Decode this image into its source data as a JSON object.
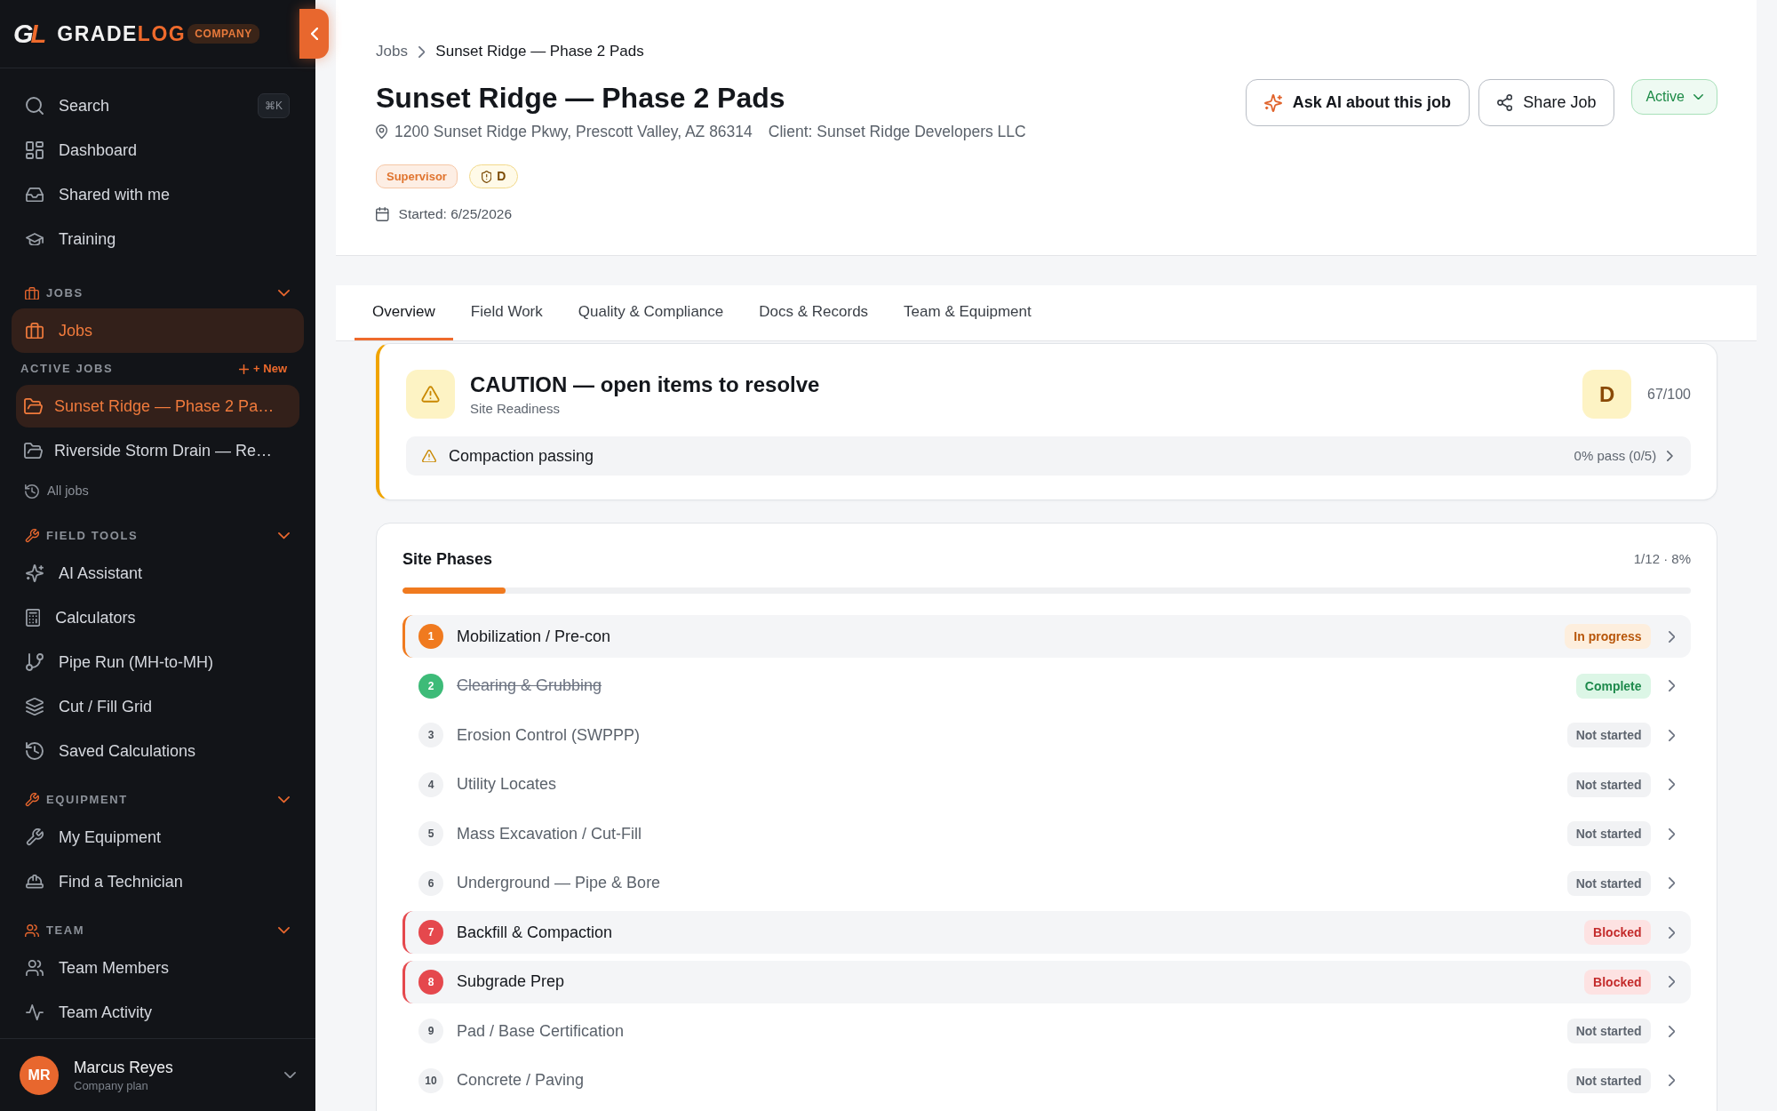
{
  "sidebar": {
    "brand": {
      "mark": [
        {
          "text": "G",
          "accent": false
        },
        {
          "text": "L",
          "accent": true
        }
      ],
      "wordmark": [
        {
          "text": "GRADE",
          "accent": false
        },
        {
          "text": "LOG",
          "accent": true
        }
      ],
      "tag": "COMPANY"
    },
    "search": {
      "label": "Search",
      "shortcut": "⌘K"
    },
    "top_items": [
      {
        "label": "Dashboard",
        "selected": false
      },
      {
        "label": "Shared with me",
        "selected": false
      },
      {
        "label": "Training",
        "selected": false
      }
    ],
    "sections": [
      {
        "title": "JOBS",
        "expanded": true,
        "items": [
          {
            "label": "Jobs",
            "selected": true
          }
        ],
        "active_jobs": {
          "title": "ACTIVE JOBS",
          "action": "+ New",
          "items": [
            {
              "label": "Sunset Ridge — Phase 2 Pa…",
              "selected": true
            },
            {
              "label": "Riverside Storm Drain — Re…",
              "selected": false
            }
          ],
          "link": "All jobs"
        }
      },
      {
        "title": "FIELD TOOLS",
        "expanded": true,
        "items": [
          {
            "label": "AI Assistant",
            "selected": false
          },
          {
            "label": "Calculators",
            "selected": false
          },
          {
            "label": "Pipe Run (MH-to-MH)",
            "selected": false
          },
          {
            "label": "Cut / Fill Grid",
            "selected": false
          },
          {
            "label": "Saved Calculations",
            "selected": false
          }
        ]
      },
      {
        "title": "EQUIPMENT",
        "expanded": true,
        "items": [
          {
            "label": "My Equipment",
            "selected": false
          },
          {
            "label": "Find a Technician",
            "selected": false
          }
        ]
      },
      {
        "title": "TEAM",
        "expanded": true,
        "items": [
          {
            "label": "Team Members",
            "selected": false
          },
          {
            "label": "Team Activity",
            "selected": false
          }
        ]
      }
    ],
    "user": {
      "initials": "MR",
      "name": "Marcus Reyes",
      "plan": "Company plan"
    }
  },
  "header": {
    "breadcrumb": [
      {
        "label": "Jobs"
      },
      {
        "label": "Sunset Ridge — Phase 2 Pads"
      }
    ],
    "title": "Sunset Ridge — Phase 2 Pads",
    "address": "1200 Sunset Ridge Pkwy, Prescott Valley, AZ 86314",
    "client": "Client: Sunset Ridge Developers LLC",
    "badges": [
      {
        "kind": "role",
        "label": "Supervisor"
      },
      {
        "kind": "grade",
        "label": "D"
      }
    ],
    "started": "Started: 6/25/2026",
    "actions": [
      {
        "kind": "ai",
        "label": "Ask AI about this job"
      },
      {
        "kind": "share",
        "label": "Share Job"
      }
    ],
    "status": {
      "label": "Active"
    }
  },
  "tabs": [
    {
      "label": "Overview",
      "selected": true
    },
    {
      "label": "Field Work",
      "selected": false
    },
    {
      "label": "Quality & Compliance",
      "selected": false
    },
    {
      "label": "Docs & Records",
      "selected": false
    },
    {
      "label": "Team & Equipment",
      "selected": false
    }
  ],
  "alert": {
    "kind": "caution",
    "title": "CAUTION — open items to resolve",
    "subtitle": "Site Readiness",
    "grade": "D",
    "score": "67/100",
    "items": [
      {
        "label": "Compaction passing",
        "value": "0% pass (0/5)"
      }
    ]
  },
  "phases": {
    "title": "Site Phases",
    "summary": "1/12 · 8%",
    "progress": {
      "level": 0.08
    },
    "rows": [
      {
        "number": "1",
        "name": "Mobilization / Pre-con",
        "kind": "in_progress",
        "status": "In progress"
      },
      {
        "number": "2",
        "name": "Clearing & Grubbing",
        "kind": "complete",
        "status": "Complete"
      },
      {
        "number": "3",
        "name": "Erosion Control (SWPPP)",
        "kind": "not_started",
        "status": "Not started"
      },
      {
        "number": "4",
        "name": "Utility Locates",
        "kind": "not_started",
        "status": "Not started"
      },
      {
        "number": "5",
        "name": "Mass Excavation / Cut-Fill",
        "kind": "not_started",
        "status": "Not started"
      },
      {
        "number": "6",
        "name": "Underground — Pipe & Bore",
        "kind": "not_started",
        "status": "Not started"
      },
      {
        "number": "7",
        "name": "Backfill & Compaction",
        "kind": "blocked",
        "status": "Blocked"
      },
      {
        "number": "8",
        "name": "Subgrade Prep",
        "kind": "blocked",
        "status": "Blocked"
      },
      {
        "number": "9",
        "name": "Pad / Base Certification",
        "kind": "not_started",
        "status": "Not started"
      },
      {
        "number": "10",
        "name": "Concrete / Paving",
        "kind": "not_started",
        "status": "Not started"
      }
    ]
  }
}
